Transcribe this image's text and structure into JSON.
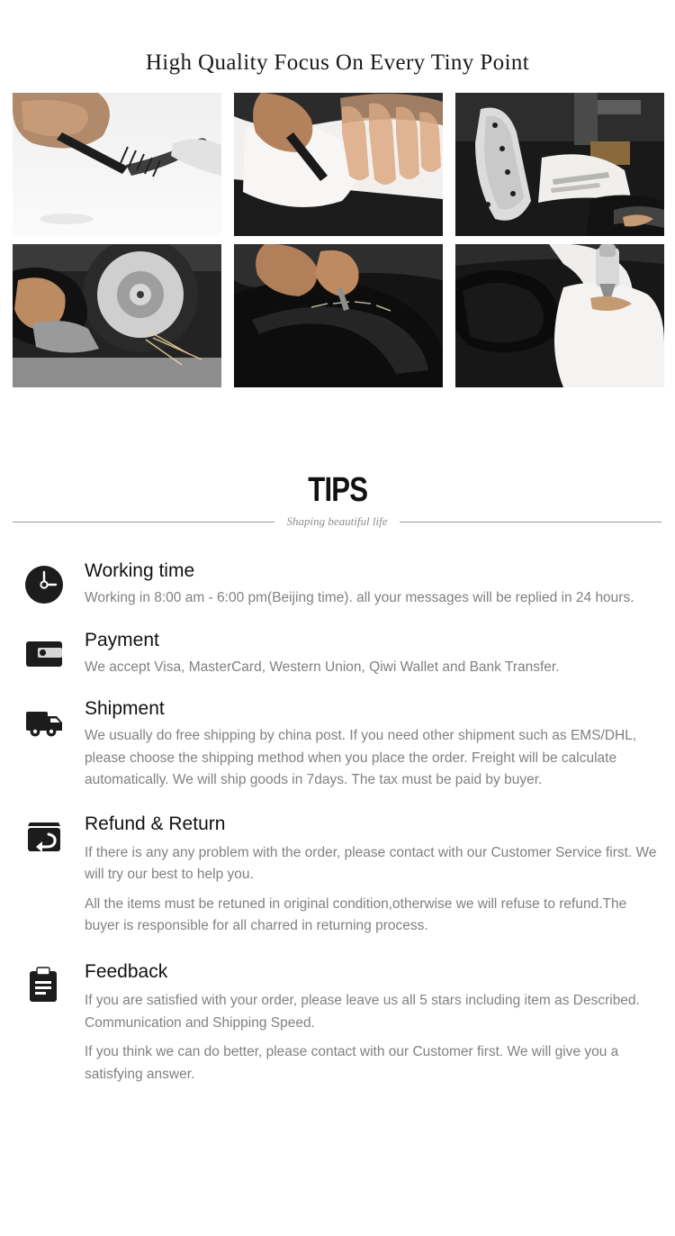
{
  "banner": {
    "title": "High Quality Focus On Every Tiny Point"
  },
  "gallery": {
    "rows": [
      [
        {
          "alt": "hand-drawing-pattern-with-pen"
        },
        {
          "alt": "hands-cutting-leather-with-knife"
        },
        {
          "alt": "metal-template-on-leather-cutting-machine"
        }
      ],
      [
        {
          "alt": "hand-grinding-edge-on-polishing-wheel"
        },
        {
          "alt": "hands-stitching-black-leather-bag"
        },
        {
          "alt": "applying-edge-paint-to-leather-piece"
        }
      ]
    ]
  },
  "tips": {
    "heading": "TIPS",
    "subheading": "Shaping beautiful life",
    "sections": [
      {
        "icon": "clock-icon",
        "title": "Working time",
        "paragraphs": [
          "Working in 8:00 am - 6:00 pm(Beijing time). all your messages will be replied in 24 hours."
        ]
      },
      {
        "icon": "wallet-icon",
        "title": "Payment",
        "paragraphs": [
          "We accept Visa, MasterCard, Western Union, Qiwi Wallet and Bank Transfer."
        ]
      },
      {
        "icon": "truck-icon",
        "title": "Shipment",
        "paragraphs": [
          "We usually do free shipping by china post. If you need other shipment such as EMS/DHL, please choose the shipping method when you place the order. Freight will be calculate automatically. We will ship goods in 7days. The tax must be paid by buyer."
        ]
      },
      {
        "icon": "return-box-icon",
        "title": "Refund & Return",
        "paragraphs": [
          "If there is any any problem with the order, please contact with our Customer Service first. We will try our best to help you.",
          "All the items must be retuned in original condition,otherwise we will refuse to refund.The buyer is responsible for all charred in returning process."
        ]
      },
      {
        "icon": "clipboard-icon",
        "title": "Feedback",
        "paragraphs": [
          "If you are satisfied with your order, please leave us all 5 stars including item as Described. Communication and Shipping Speed.",
          "If you think we can do better, please contact with our Customer first. We will give you a satisfying answer."
        ]
      }
    ]
  },
  "colors": {
    "heading": "#111111",
    "body_text": "#818181",
    "rule": "#9b9b9b",
    "icon": "#1c1c1c",
    "background": "#ffffff"
  }
}
